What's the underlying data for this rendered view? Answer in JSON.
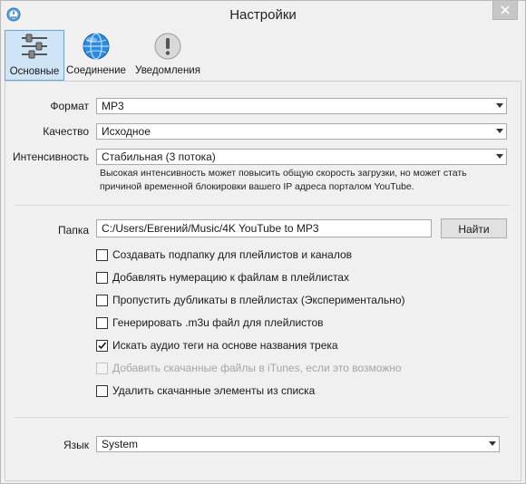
{
  "window": {
    "title": "Настройки"
  },
  "tabs": [
    {
      "label": "Основные",
      "icon": "sliders-icon",
      "active": true
    },
    {
      "label": "Соединение",
      "icon": "globe-icon",
      "active": false
    },
    {
      "label": "Уведомления",
      "icon": "exclamation-icon",
      "active": false
    }
  ],
  "general": {
    "format": {
      "label": "Формат",
      "value": "MP3"
    },
    "quality": {
      "label": "Качество",
      "value": "Исходное"
    },
    "intensity": {
      "label": "Интенсивность",
      "value": "Стабильная (3 потока)"
    },
    "hint_line1": "Высокая интенсивность может повысить общую скорость загрузки, но может стать",
    "hint_line2": "причиной временной блокировки вашего IP адреса порталом YouTube.",
    "folder": {
      "label": "Папка",
      "value": "C:/Users/Евгений/Music/4K YouTube to MP3",
      "button": "Найти"
    },
    "checkboxes": [
      {
        "label": "Создавать подпапку для плейлистов и каналов",
        "checked": false,
        "disabled": false
      },
      {
        "label": "Добавлять нумерацию к файлам в плейлистах",
        "checked": false,
        "disabled": false
      },
      {
        "label": "Пропустить дубликаты в плейлистах (Экспериментально)",
        "checked": false,
        "disabled": false
      },
      {
        "label": "Генерировать .m3u файл для плейлистов",
        "checked": false,
        "disabled": false
      },
      {
        "label": "Искать аудио теги на основе названия трека",
        "checked": true,
        "disabled": false
      },
      {
        "label": "Добавить скачанные файлы в iTunes, если это возможно",
        "checked": false,
        "disabled": true
      },
      {
        "label": "Удалить скачанные элементы из списка",
        "checked": false,
        "disabled": false
      }
    ],
    "language": {
      "label": "Язык",
      "value": "System"
    }
  },
  "colors": {
    "accent": "#cfe4f7",
    "accent_border": "#6aa6d9",
    "close_bg": "#c7c7c7"
  }
}
